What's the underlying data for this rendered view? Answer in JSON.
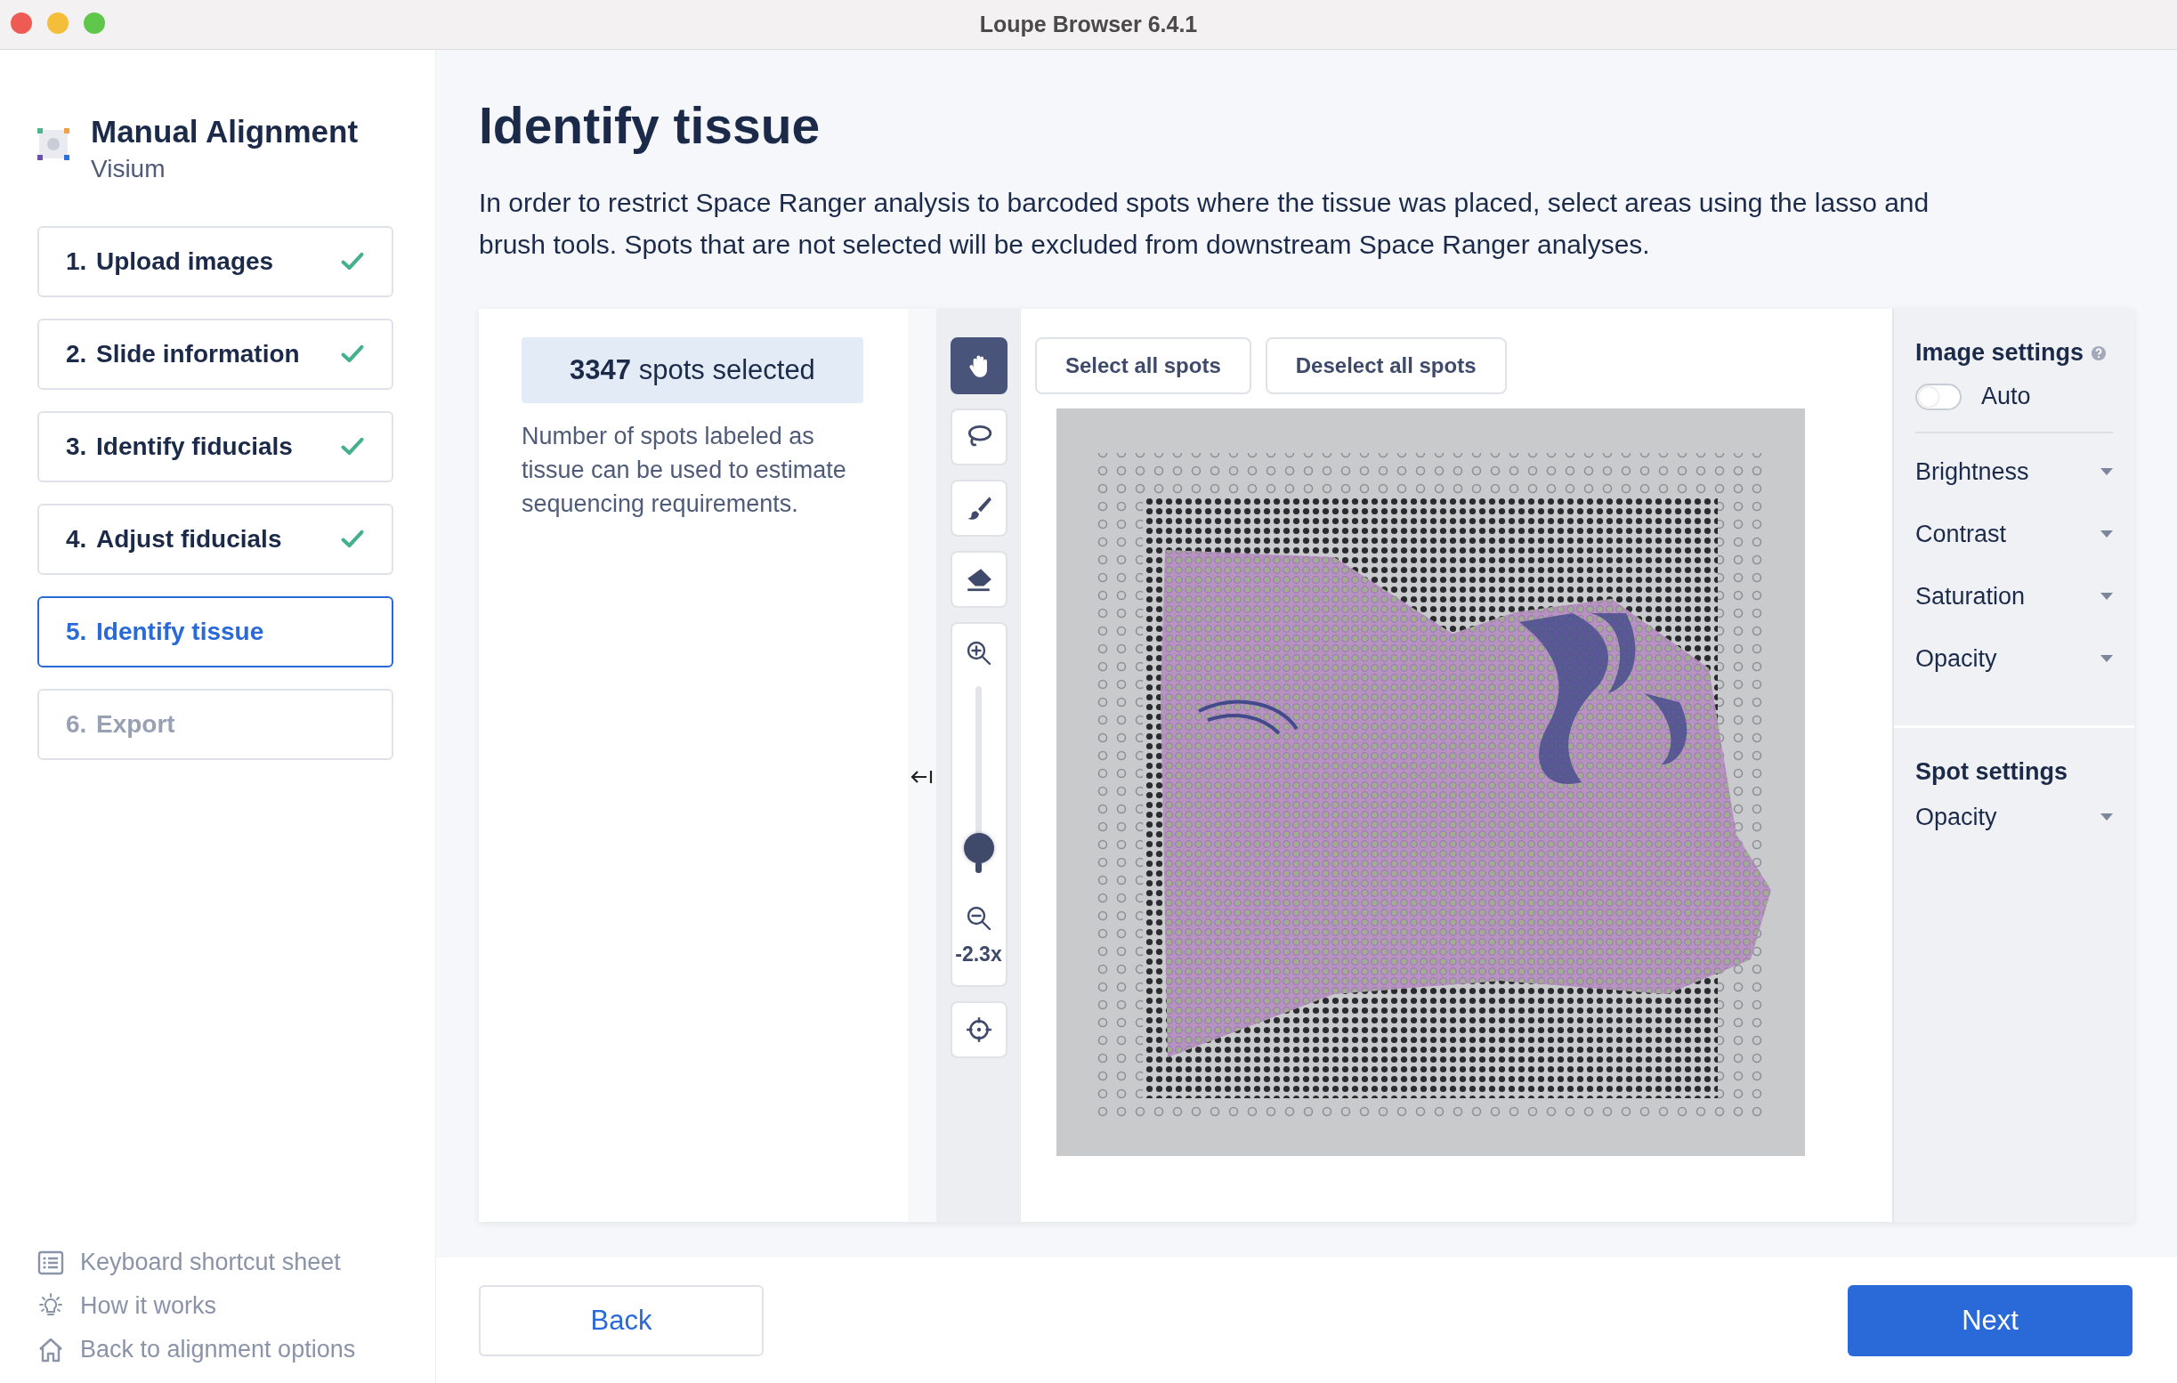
{
  "window": {
    "title": "Loupe Browser 6.4.1"
  },
  "sidebar": {
    "title": "Manual Alignment",
    "subtitle": "Visium",
    "steps": [
      {
        "number": "1.",
        "label": "Upload images",
        "done": true,
        "selected": false,
        "disabled": false
      },
      {
        "number": "2.",
        "label": "Slide information",
        "done": true,
        "selected": false,
        "disabled": false
      },
      {
        "number": "3.",
        "label": "Identify fiducials",
        "done": true,
        "selected": false,
        "disabled": false
      },
      {
        "number": "4.",
        "label": "Adjust fiducials",
        "done": true,
        "selected": false,
        "disabled": false
      },
      {
        "number": "5.",
        "label": "Identify tissue",
        "done": false,
        "selected": true,
        "disabled": false
      },
      {
        "number": "6.",
        "label": "Export",
        "done": false,
        "selected": false,
        "disabled": true
      }
    ],
    "links": [
      {
        "kind": "list",
        "label": "Keyboard shortcut sheet"
      },
      {
        "kind": "bulb",
        "label": "How it works"
      },
      {
        "kind": "home",
        "label": "Back to alignment options"
      }
    ]
  },
  "main": {
    "heading": "Identify tissue",
    "description": "In order to restrict Space Ranger analysis to barcoded spots where the tissue was placed, select areas using the lasso and brush tools. Spots that are not selected will be excluded from downstream Space Ranger analyses.",
    "spots_badge": "**3347** spots selected",
    "spots_note": "Number of spots labeled as tissue can be used to estimate sequencing requirements.",
    "tools": [
      {
        "kind": "hand",
        "selected": true
      },
      {
        "kind": "lasso",
        "selected": false
      },
      {
        "kind": "brush",
        "selected": false
      },
      {
        "kind": "eraser",
        "selected": false
      }
    ],
    "zoom": {
      "level": 0.06,
      "reading": "-2.3x"
    },
    "selection_buttons": [
      "Select all spots",
      "Deselect all spots"
    ]
  },
  "settings": {
    "image": {
      "title": "Image settings",
      "auto": {
        "label": "Auto",
        "on": false
      },
      "rows": [
        "Brightness",
        "Contrast",
        "Saturation",
        "Opacity"
      ]
    },
    "spot": {
      "title": "Spot settings",
      "rows": [
        "Opacity"
      ]
    }
  },
  "footer": {
    "back": "Back",
    "next": "Next"
  }
}
